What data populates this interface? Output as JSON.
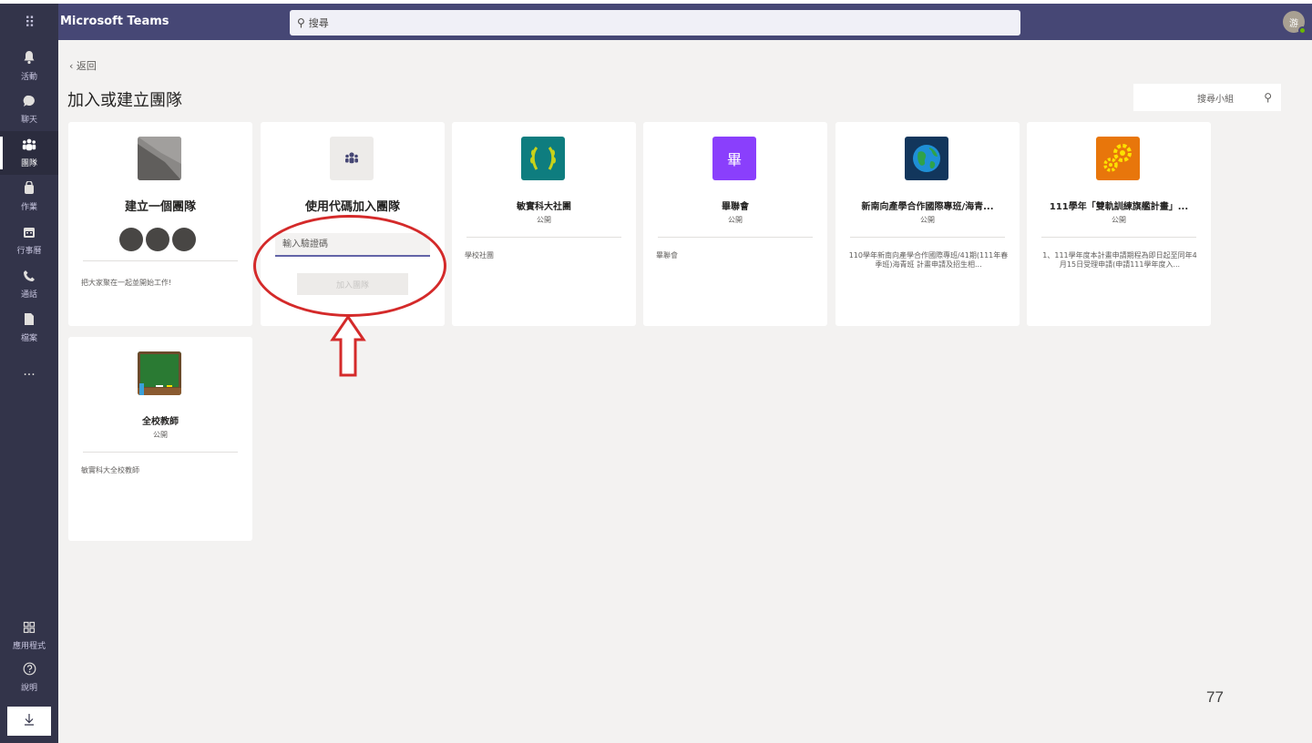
{
  "app": {
    "title": "Microsoft Teams",
    "waffle_icon": "grid-dots-icon",
    "search_placeholder": "搜尋",
    "avatar_initial": "游"
  },
  "rail": {
    "items": [
      {
        "label": "活動",
        "icon": "bell-icon",
        "glyph": "🔔"
      },
      {
        "label": "聊天",
        "icon": "chat-icon",
        "glyph": "💬"
      },
      {
        "label": "團隊",
        "icon": "teams-icon",
        "glyph": "👥",
        "active": true
      },
      {
        "label": "作業",
        "icon": "assignments-icon",
        "glyph": "🎒"
      },
      {
        "label": "行事曆",
        "icon": "calendar-icon",
        "glyph": "📅"
      },
      {
        "label": "通話",
        "icon": "phone-icon",
        "glyph": "📞"
      },
      {
        "label": "檔案",
        "icon": "file-icon",
        "glyph": "📄"
      }
    ],
    "more": "...",
    "bottom": [
      {
        "label": "應用程式",
        "icon": "apps-icon",
        "glyph": "⊞"
      },
      {
        "label": "說明",
        "icon": "help-icon",
        "glyph": "?"
      }
    ],
    "download_icon": "download-icon"
  },
  "main": {
    "back_label": "‹  返回",
    "title": "加入或建立團隊",
    "team_search_placeholder": "搜尋小組"
  },
  "create_card": {
    "title": "建立一個團隊",
    "description": "把大家聚在一起並開始工作!"
  },
  "join_card": {
    "title": "使用代碼加入團隊",
    "code_placeholder": "輸入驗證碼",
    "join_button": "加入團隊"
  },
  "team_cards": [
    {
      "title": "敏實科大社團",
      "privacy": "公開",
      "description": "學校社團",
      "icon": "laurel-icon",
      "color": "#0e7d7f"
    },
    {
      "title": "畢聯會",
      "privacy": "公開",
      "description": "畢聯會",
      "icon": "letter-icon",
      "color": "#8a3ffc",
      "glyph": "畢"
    },
    {
      "title": "新南向產學合作國際專班/海青...",
      "privacy": "公開",
      "description": "110學年新南向產學合作國際專班/41期(111年春季班)海青班 計畫申請及招生相...",
      "icon": "globe-icon",
      "color": "#12365c"
    },
    {
      "title": "111學年「雙軌訓練旗艦計畫」...",
      "privacy": "公開",
      "description": "1、111學年度本計畫申請期程為即日起至同年4月15日受理申請(申請111學年度入...",
      "icon": "gears-icon",
      "color": "#e8760b"
    },
    {
      "title": "全校教師",
      "privacy": "公開",
      "description": "敏實科大全校教師",
      "icon": "chalkboard-icon",
      "color": "#2a7a33"
    }
  ],
  "annotation": {
    "color": "#d42a2a"
  },
  "page_number": "77"
}
